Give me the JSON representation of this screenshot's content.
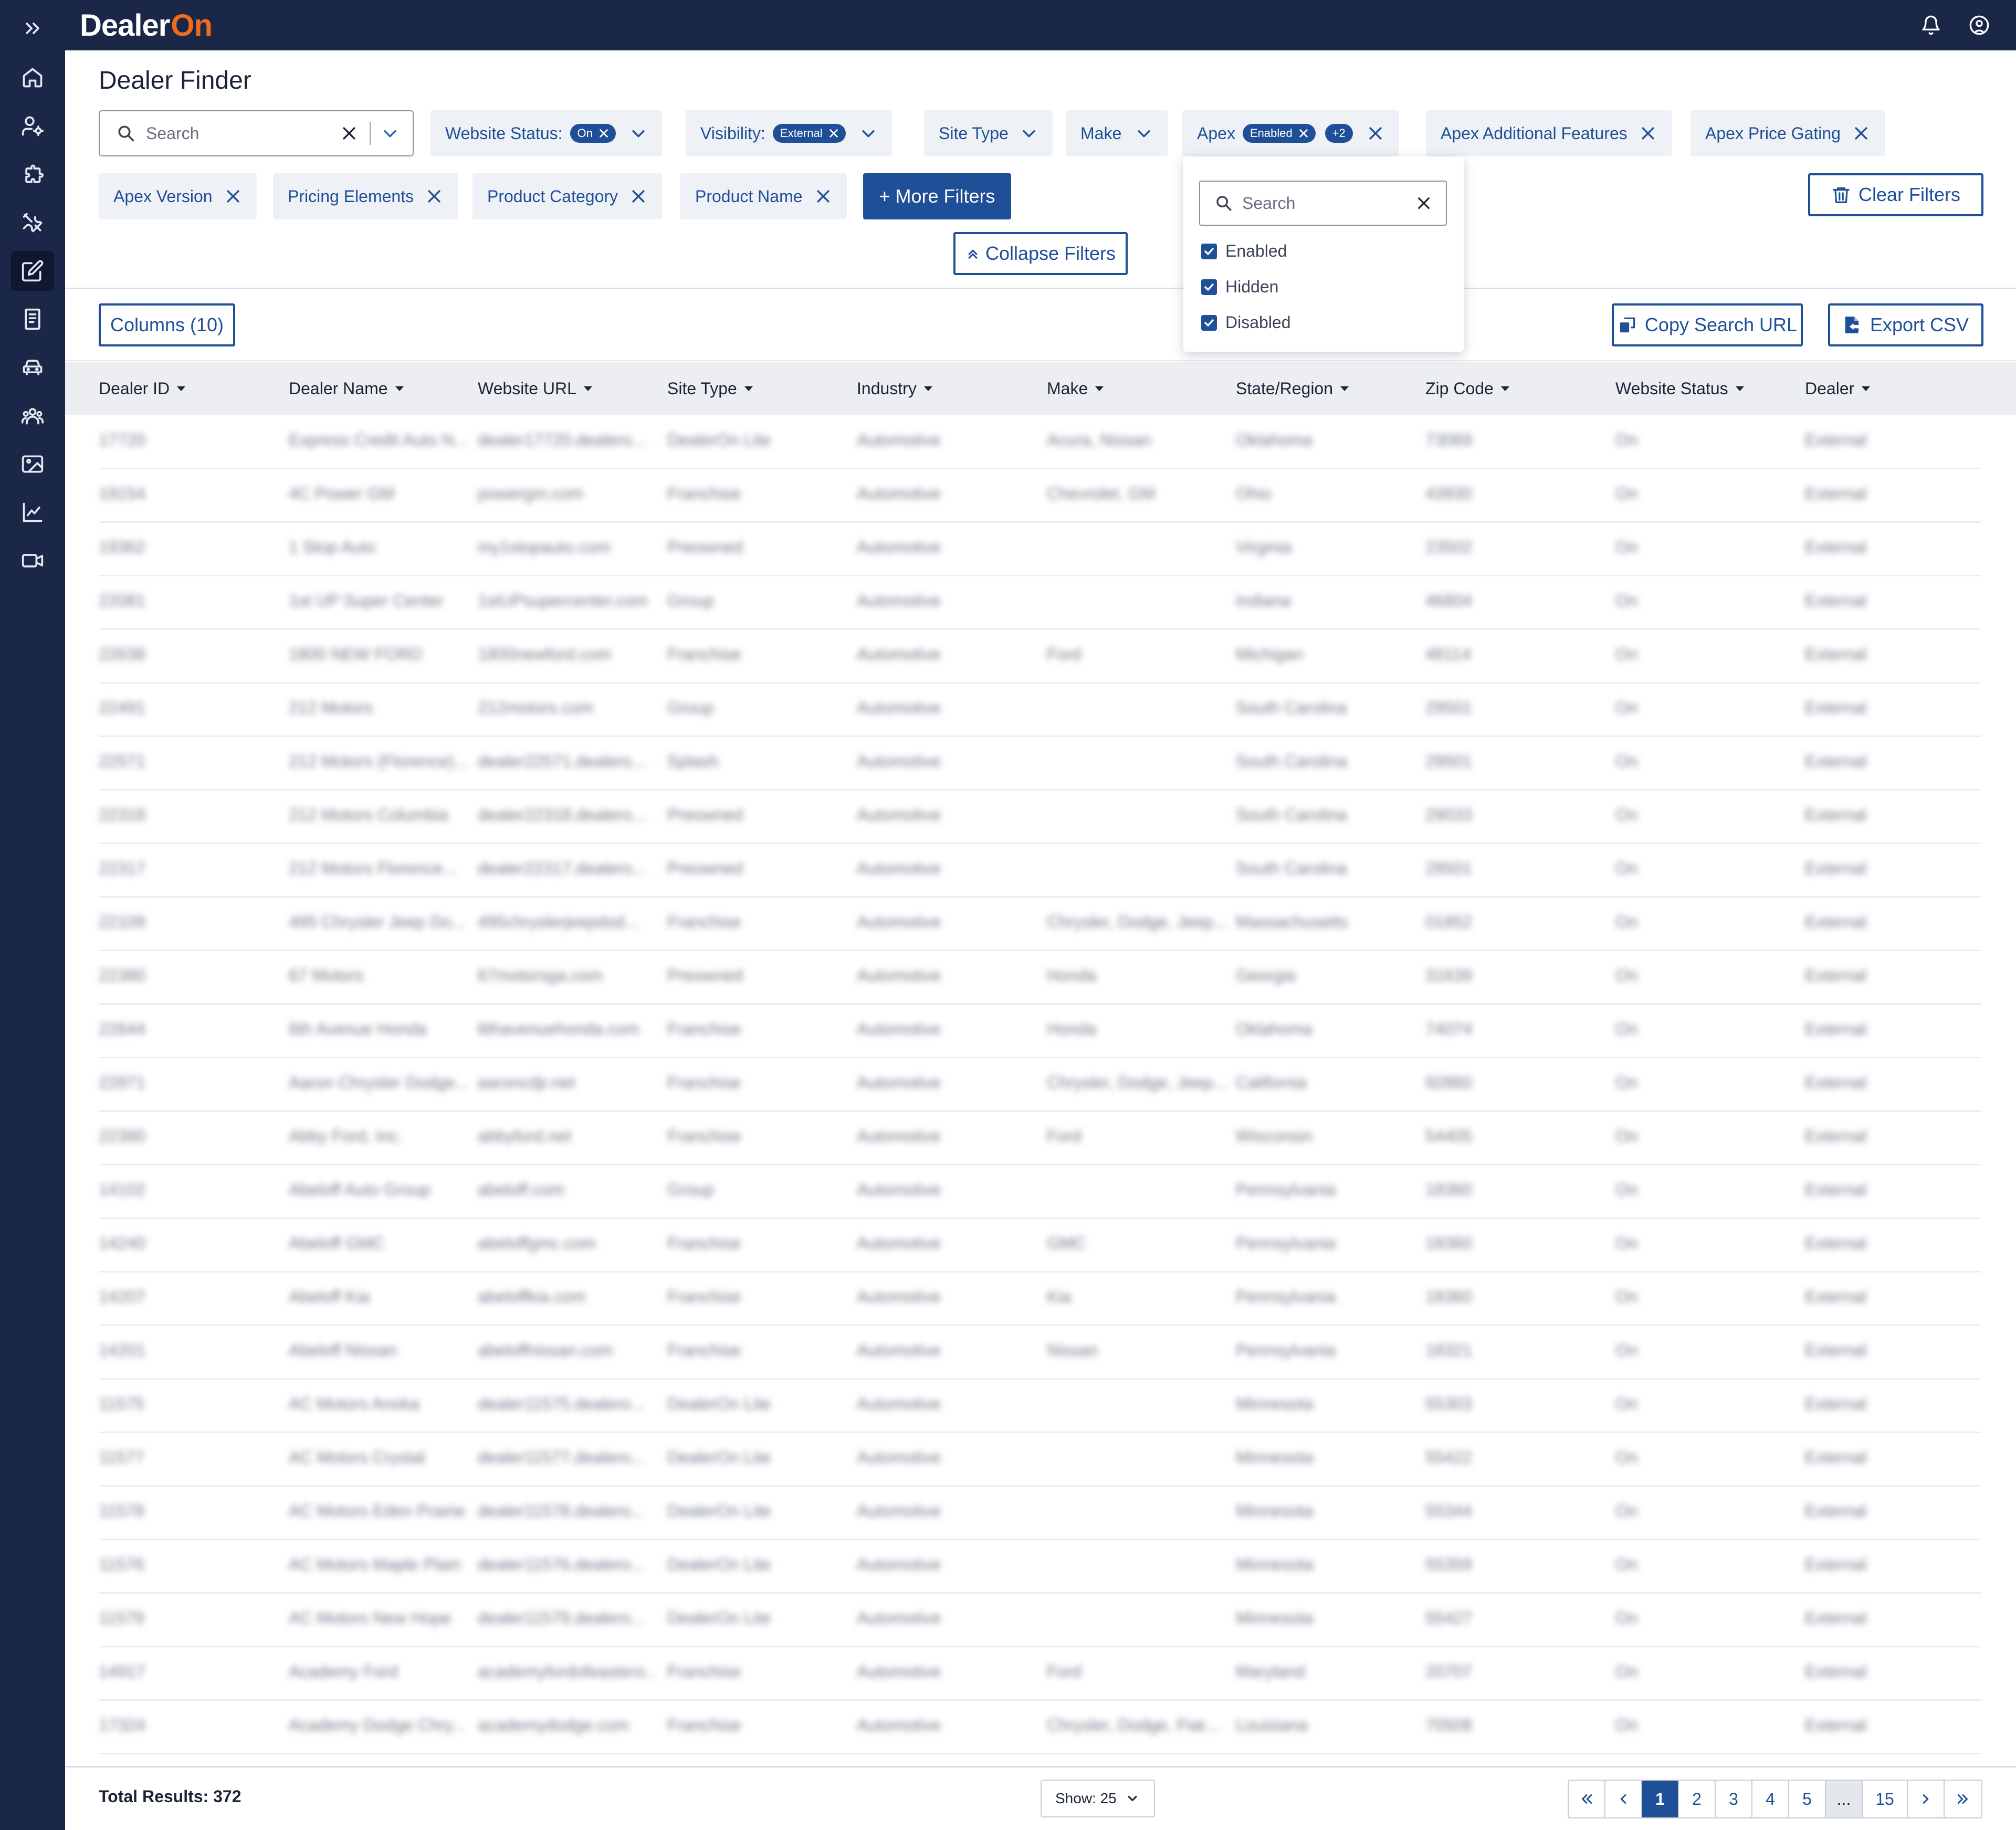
{
  "app": {
    "logo_main": "Dealer",
    "logo_accent": "On"
  },
  "page": {
    "title": "Dealer Finder"
  },
  "search": {
    "placeholder": "Search"
  },
  "filters": {
    "website_status": {
      "label": "Website Status:",
      "value": "On"
    },
    "visibility": {
      "label": "Visibility:",
      "value": "External"
    },
    "site_type": {
      "label": "Site Type"
    },
    "make": {
      "label": "Make"
    },
    "apex": {
      "label": "Apex",
      "value": "Enabled",
      "extra": "+2"
    },
    "apex_additional_features": {
      "label": "Apex Additional Features"
    },
    "apex_price_gating": {
      "label": "Apex Price Gating"
    },
    "apex_version": {
      "label": "Apex Version"
    },
    "pricing_elements": {
      "label": "Pricing Elements"
    },
    "product_category": {
      "label": "Product Category"
    },
    "product_name": {
      "label": "Product Name"
    },
    "more_filters": "+ More Filters",
    "collapse_filters": "Collapse Filters",
    "clear_filters": "Clear Filters"
  },
  "apex_dropdown": {
    "search_placeholder": "Search",
    "options": [
      {
        "label": "Enabled",
        "checked": true
      },
      {
        "label": "Hidden",
        "checked": true
      },
      {
        "label": "Disabled",
        "checked": true
      }
    ]
  },
  "toolbar": {
    "columns": "Columns (10)",
    "copy_url": "Copy Search URL",
    "export_csv": "Export CSV"
  },
  "table": {
    "headers": [
      "Dealer ID",
      "Dealer Name",
      "Website URL",
      "Site Type",
      "Industry",
      "Make",
      "State/Region",
      "Zip Code",
      "Website Status",
      "Dealer"
    ],
    "rows": [
      [
        "17720",
        "Express Credit Auto N...",
        "dealer17720.dealero...",
        "DealerOn Lite",
        "Automotive",
        "Acura, Nissan",
        "Oklahoma",
        "73069",
        "On",
        "External"
      ],
      [
        "19154",
        "4C Power GM",
        "powergm.com",
        "Franchise",
        "Automotive",
        "Chevrolet, GM",
        "Ohio",
        "43930",
        "On",
        "External"
      ],
      [
        "19362",
        "1 Stop Auto",
        "my1stopauto.com",
        "Preowned",
        "Automotive",
        "",
        "Virginia",
        "23502",
        "On",
        "External"
      ],
      [
        "22081",
        "1st UP Super Center",
        "1stUPsupercenter.com",
        "Group",
        "Automotive",
        "",
        "Indiana",
        "46804",
        "On",
        "External"
      ],
      [
        "22638",
        "1800 NEW FORD",
        "1800newford.com",
        "Franchise",
        "Automotive",
        "Ford",
        "Michigan",
        "48114",
        "On",
        "External"
      ],
      [
        "22491",
        "212 Motors",
        "212motors.com",
        "Group",
        "Automotive",
        "",
        "South Carolina",
        "29501",
        "On",
        "External"
      ],
      [
        "22571",
        "212 Motors (Florence)...",
        "dealer22571.dealero...",
        "Splash",
        "Automotive",
        "",
        "South Carolina",
        "29501",
        "On",
        "External"
      ],
      [
        "22318",
        "212 Motors Columbia",
        "dealer22318.dealero...",
        "Preowned",
        "Automotive",
        "",
        "South Carolina",
        "29033",
        "On",
        "External"
      ],
      [
        "22317",
        "212 Motors Florence...",
        "dealer22317.dealero...",
        "Preowned",
        "Automotive",
        "",
        "South Carolina",
        "29501",
        "On",
        "External"
      ],
      [
        "22109",
        "495 Chrysler Jeep Do...",
        "495chryslerjeepdod...",
        "Franchise",
        "Automotive",
        "Chrysler, Dodge, Jeep...",
        "Massachusetts",
        "01852",
        "On",
        "External"
      ],
      [
        "22380",
        "67 Motors",
        "67motorsga.com",
        "Preowned",
        "Automotive",
        "Honda",
        "Georgia",
        "31639",
        "On",
        "External"
      ],
      [
        "22644",
        "6th Avenue Honda",
        "6thavenuehonda.com",
        "Franchise",
        "Automotive",
        "Honda",
        "Oklahoma",
        "74074",
        "On",
        "External"
      ],
      [
        "22971",
        "Aaron Chrysler Dodge...",
        "aaroncdjr.net",
        "Franchise",
        "Automotive",
        "Chrysler, Dodge, Jeep...",
        "California",
        "92860",
        "On",
        "External"
      ],
      [
        "22390",
        "Abby Ford, Inc.",
        "abbyford.net",
        "Franchise",
        "Automotive",
        "Ford",
        "Wisconsin",
        "54405",
        "On",
        "External"
      ],
      [
        "14102",
        "Abeloff Auto Group",
        "abeloff.com",
        "Group",
        "Automotive",
        "",
        "Pennsylvania",
        "18360",
        "On",
        "External"
      ],
      [
        "14240",
        "Abeloff GMC",
        "abeloffgmc.com",
        "Franchise",
        "Automotive",
        "GMC",
        "Pennsylvania",
        "18360",
        "On",
        "External"
      ],
      [
        "14207",
        "Abeloff Kia",
        "abeloffkia.com",
        "Franchise",
        "Automotive",
        "Kia",
        "Pennsylvania",
        "18360",
        "On",
        "External"
      ],
      [
        "14201",
        "Abeloff Nissan",
        "abeloffnissan.com",
        "Franchise",
        "Automotive",
        "Nissan",
        "Pennsylvania",
        "18321",
        "On",
        "External"
      ],
      [
        "11575",
        "AC Motors Anoka",
        "dealer11575.dealero...",
        "DealerOn Lite",
        "Automotive",
        "",
        "Minnesota",
        "55303",
        "On",
        "External"
      ],
      [
        "11577",
        "AC Motors Crystal",
        "dealer11577.dealero...",
        "DealerOn Lite",
        "Automotive",
        "",
        "Minnesota",
        "55422",
        "On",
        "External"
      ],
      [
        "11578",
        "AC Motors Eden Prairie",
        "dealer11578.dealero...",
        "DealerOn Lite",
        "Automotive",
        "",
        "Minnesota",
        "55344",
        "On",
        "External"
      ],
      [
        "11576",
        "AC Motors Maple Plain",
        "dealer11576.dealero...",
        "DealerOn Lite",
        "Automotive",
        "",
        "Minnesota",
        "55359",
        "On",
        "External"
      ],
      [
        "11579",
        "AC Motors New Hope",
        "dealer11579.dealero...",
        "DealerOn Lite",
        "Automotive",
        "",
        "Minnesota",
        "55427",
        "On",
        "External"
      ],
      [
        "14917",
        "Academy Ford",
        "academyfordofeastero...",
        "Franchise",
        "Automotive",
        "Ford",
        "Maryland",
        "20707",
        "On",
        "External"
      ],
      [
        "17324",
        "Academy Dodge Chry...",
        "academydodge.com",
        "Franchise",
        "Automotive",
        "Chrysler, Dodge, Fiat...",
        "Louisiana",
        "70508",
        "On",
        "External"
      ]
    ]
  },
  "footer": {
    "total": "Total Results: 372",
    "show": "Show: 25",
    "pages": [
      "1",
      "2",
      "3",
      "4",
      "5",
      "...",
      "15"
    ],
    "current_page": "1"
  },
  "colors": {
    "navy": "#1b2747",
    "brand_blue": "#1f4f96",
    "accent_orange": "#f26b1d"
  },
  "icons": {
    "sidebar": [
      "expand-icon",
      "home-icon",
      "user-settings-icon",
      "puzzle-icon",
      "tools-icon",
      "edit-icon",
      "receipt-icon",
      "car-icon",
      "users-icon",
      "image-icon",
      "chart-icon",
      "video-icon"
    ],
    "topbar": [
      "bell-icon",
      "account-icon"
    ]
  }
}
